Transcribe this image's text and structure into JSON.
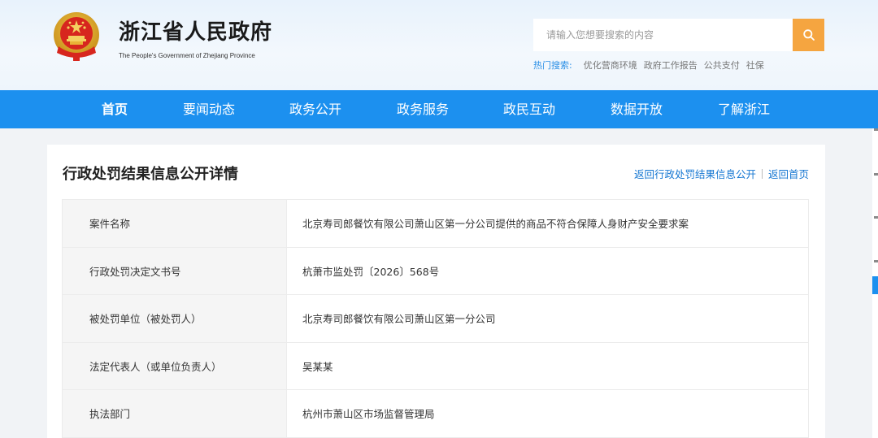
{
  "header": {
    "site_title": "浙江省人民政府",
    "site_subtitle": "The People's Government of Zhejiang Province",
    "search_placeholder": "请输入您想要搜索的内容",
    "hot_search_label": "热门搜索:",
    "hot_search_items": [
      "优化营商环境",
      "政府工作报告",
      "公共支付",
      "社保"
    ]
  },
  "nav": {
    "items": [
      {
        "label": "首页"
      },
      {
        "label": "要闻动态"
      },
      {
        "label": "政务公开"
      },
      {
        "label": "政务服务"
      },
      {
        "label": "政民互动"
      },
      {
        "label": "数据开放"
      },
      {
        "label": "了解浙江"
      }
    ]
  },
  "page": {
    "title": "行政处罚结果信息公开详情",
    "back_to_list": "返回行政处罚结果信息公开",
    "back_to_home": "返回首页"
  },
  "details": [
    {
      "label": "案件名称",
      "value": "北京寿司郎餐饮有限公司萧山区第一分公司提供的商品不符合保障人身财产安全要求案"
    },
    {
      "label": "行政处罚决定文书号",
      "value": "杭萧市监处罚〔2026〕568号"
    },
    {
      "label": "被处罚单位（被处罚人）",
      "value": "北京寿司郎餐饮有限公司萧山区第一分公司"
    },
    {
      "label": "法定代表人（或单位负责人）",
      "value": "吴某某"
    },
    {
      "label": "执法部门",
      "value": "杭州市萧山区市场监督管理局"
    }
  ],
  "icons": {
    "emblem": "national-emblem-icon",
    "search": "search-icon"
  },
  "colors": {
    "nav_blue": "#1c90ef",
    "search_orange": "#f5a540",
    "link_blue": "#1677d2"
  }
}
